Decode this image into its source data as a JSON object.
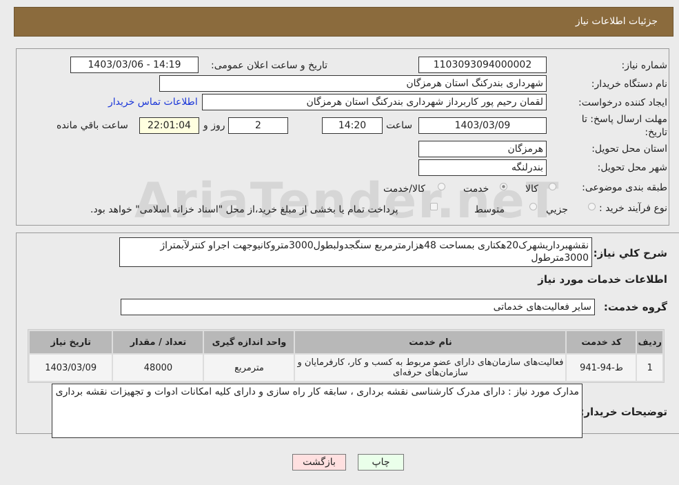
{
  "header": {
    "title": "جزئیات اطلاعات نیاز"
  },
  "fields": {
    "need_number_label": "شماره نیاز:",
    "need_number": "1103093094000002",
    "announce_label": "تاریخ و ساعت اعلان عمومی:",
    "announce_value": "1403/03/06 - 14:19",
    "buyer_org_label": "نام دستگاه خریدار:",
    "buyer_org": "شهرداری بندرکنگ استان هرمزگان",
    "creator_label": "ایجاد کننده درخواست:",
    "creator": "لقمان رحیم پور کاربرداز شهرداری بندرکنگ استان هرمزگان",
    "contact_link": "اطلاعات تماس خریدار",
    "deadline_label": "مهلت ارسال پاسخ: تا تاریخ:",
    "deadline_date": "1403/03/09",
    "time_label": "ساعت",
    "deadline_time": "14:20",
    "days": "2",
    "days_label": "روز و",
    "remaining": "22:01:04",
    "remaining_label": "ساعت باقي مانده",
    "province_label": "استان محل تحویل:",
    "province": "هرمزگان",
    "city_label": "شهر محل تحویل:",
    "city": "بندرلنگه",
    "category_label": "طبقه بندی موضوعی:",
    "category_options": [
      "کالا",
      "خدمت",
      "کالا/خدمت"
    ],
    "category_selected": "خدمت",
    "process_label": "نوع فرآیند خرید :",
    "process_options": [
      "جزيي",
      "متوسط"
    ],
    "process_note": "پرداخت تمام یا بخشی از مبلغ خرید،از محل \"اسناد خزانه اسلامی\" خواهد بود."
  },
  "description": {
    "label": "شرح كلي نياز:",
    "text": "نقشهبرداریشهرک20هکتاری بمساحت 48هزارمترمربع سنگجدولبطول3000متروکانیوجهت اجراو کنترلآبمتراژ 3000مترطول"
  },
  "services": {
    "section_title": "اطلاعات خدمات مورد نیاز",
    "group_label": "گروه خدمت:",
    "group": "سایر فعالیت‌های خدماتی",
    "columns": [
      "ردیف",
      "کد خدمت",
      "نام خدمت",
      "واحد اندازه گیری",
      "تعداد / مقدار",
      "تاریخ نیاز"
    ],
    "rows": [
      [
        "1",
        "ط-94-941",
        "فعالیت‌های سازمان‌های دارای عضو مربوط به کسب و کار، کارفرمایان و سازمان‌های حرفه‌ای",
        "مترمربع",
        "48000",
        "1403/03/09"
      ]
    ]
  },
  "buyer_notes": {
    "label": "توضیحات خریدار:",
    "text": "مدارک مورد نیاز : دارای مدرک کارشناسی نقشه برداری ، سابقه کار راه سازی و دارای کلیه امکانات ادوات و تجهیزات نقشه برداری"
  },
  "buttons": {
    "print": "چاپ",
    "back": "بازگشت"
  },
  "watermark": "AriaTender.neT"
}
